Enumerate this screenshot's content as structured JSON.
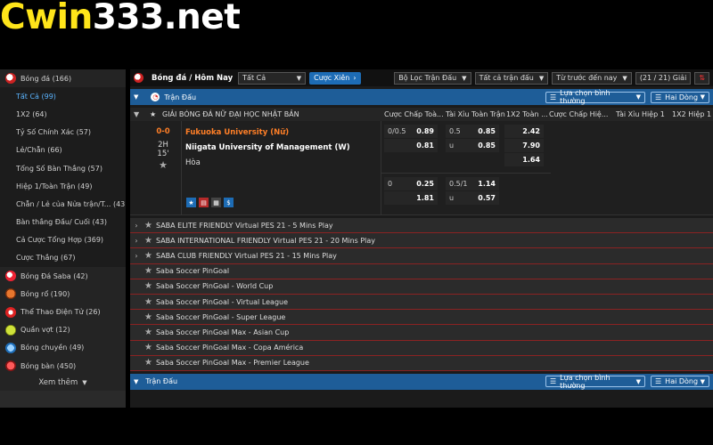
{
  "logo": {
    "part1": "Cwin",
    "part2": "333.net"
  },
  "sidebar": {
    "items": [
      {
        "icon": "soccer-ball-icon",
        "label": "Bóng đá (166)",
        "type": "main",
        "cls": "b-soccer"
      },
      {
        "label": "Tất Cả (99)",
        "type": "sub",
        "active": true
      },
      {
        "label": "1X2 (64)",
        "type": "sub"
      },
      {
        "label": "Tỷ Số Chính Xác (57)",
        "type": "sub"
      },
      {
        "label": "Lẻ/Chẵn (66)",
        "type": "sub"
      },
      {
        "label": "Tổng Số Bàn Thắng (57)",
        "type": "sub"
      },
      {
        "label": "Hiệp 1/Toàn Trận (49)",
        "type": "sub"
      },
      {
        "label": "Chẵn / Lẻ của Nửa trận/T... (43)",
        "type": "sub"
      },
      {
        "label": "Bàn thắng Đầu/ Cuối (43)",
        "type": "sub"
      },
      {
        "label": "Cả Cược Tổng Hợp (369)",
        "type": "sub"
      },
      {
        "label": "Cược Thắng (67)",
        "type": "sub"
      },
      {
        "icon": "saba-soccer-icon",
        "label": "Bóng Đá Saba (42)",
        "type": "main",
        "cls": "b-saba"
      },
      {
        "icon": "basketball-icon",
        "label": "Bóng rổ (190)",
        "type": "main",
        "cls": "b-basket"
      },
      {
        "icon": "esports-icon",
        "label": "Thể Thao Điện Tử (26)",
        "type": "main",
        "cls": "b-esport"
      },
      {
        "icon": "tennis-icon",
        "label": "Quần vợt (12)",
        "type": "main",
        "cls": "b-tennis"
      },
      {
        "icon": "volleyball-icon",
        "label": "Bóng chuyền (49)",
        "type": "main",
        "cls": "b-volley"
      },
      {
        "icon": "table-tennis-icon",
        "label": "Bóng bàn (450)",
        "type": "main",
        "cls": "b-ping"
      }
    ],
    "more": "Xem thêm"
  },
  "topbar": {
    "title": "Bóng đá / Hôm Nay",
    "filter": "Tất Cả",
    "parlay": "Cược Xiên",
    "match_filter": "Bộ Lọc Trận Đấu",
    "all_matches": "Tất cả trận đấu",
    "sort": "Từ trước đến nay",
    "count": "(21 / 21) Giải"
  },
  "section": {
    "title": "Trận Đấu",
    "odds_select": "Lựa chọn bình thường",
    "lines": "Hai Dòng"
  },
  "columns": {
    "league": "GIẢI BÓNG ĐÁ NỮ ĐẠI HỌC NHẬT BẢN",
    "c1": "Cược Chấp Toà...",
    "c2": "Tài Xỉu Toàn Trận",
    "c3": "1X2 Toàn ...",
    "c4": "Cược Chấp Hiệ...",
    "c5": "Tài Xỉu Hiệp 1",
    "c6": "1X2 Hiệp 1"
  },
  "match": {
    "score": "0-0",
    "period": "2H",
    "minute": "15'",
    "home": "Fukuoka University (Nữ)",
    "away": "Niigata University of Management (W)",
    "draw": "Hòa",
    "line1": {
      "hdp": "0/0.5",
      "hdp_home": "0.89",
      "hdp_away": "0.81",
      "ou": "0.5",
      "ou_o": "0.85",
      "ou_u_label": "u",
      "ou_u": "0.85",
      "x1": "2.42",
      "x2": "7.90",
      "xx": "1.64"
    },
    "line2": {
      "hdp": "0",
      "hdp_home": "0.25",
      "hdp_away": "1.81",
      "ou": "0.5/1",
      "ou_o": "1.14",
      "ou_u_label": "u",
      "ou_u": "0.57"
    }
  },
  "leagues": [
    {
      "name": "SABA ELITE FRIENDLY Virtual PES 21 - 5 Mins Play",
      "chev": true
    },
    {
      "name": "SABA INTERNATIONAL FRIENDLY Virtual PES 21 - 20 Mins Play",
      "chev": true
    },
    {
      "name": "SABA CLUB FRIENDLY Virtual PES 21 - 15 Mins Play",
      "chev": true
    },
    {
      "name": "Saba Soccer PinGoal",
      "chev": false
    },
    {
      "name": "Saba Soccer PinGoal - World Cup",
      "chev": false
    },
    {
      "name": "Saba Soccer PinGoal - Virtual League",
      "chev": false
    },
    {
      "name": "Saba Soccer PinGoal - Super League",
      "chev": false
    },
    {
      "name": "Saba Soccer PinGoal Max - Asian Cup",
      "chev": false
    },
    {
      "name": "Saba Soccer PinGoal Max - Copa América",
      "chev": false
    },
    {
      "name": "Saba Soccer PinGoal Max - Premier League",
      "chev": false
    }
  ],
  "section2": {
    "title": "Trận Đấu",
    "odds_select": "Lựa chọn bình thường",
    "lines": "Hai Dòng"
  }
}
